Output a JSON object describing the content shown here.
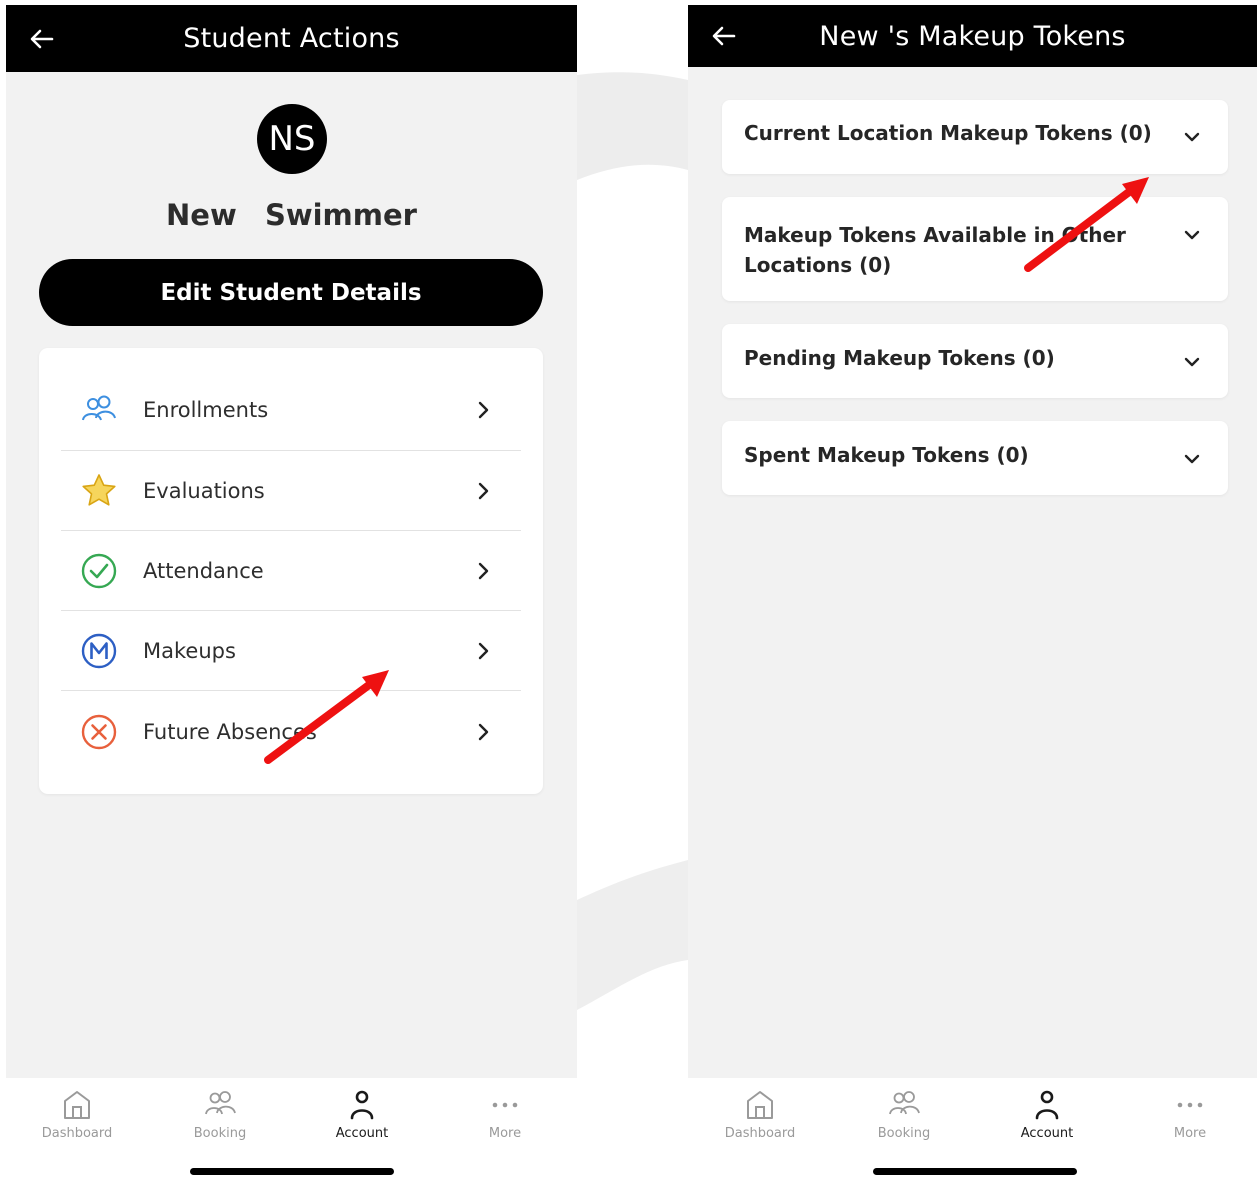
{
  "colors": {
    "header_bg": "#000000",
    "screen_bg": "#f2f2f2",
    "card_bg": "#ffffff",
    "annotation_arrow": "#ee1111",
    "nav_active": "#1a1a1a",
    "nav_inactive": "#9a9a9a"
  },
  "left_screen": {
    "header": {
      "title": "Student Actions",
      "back_icon": "arrow-left-icon"
    },
    "avatar_initials": "NS",
    "student_name": "New  Swimmer",
    "edit_button_label": "Edit Student Details",
    "menu_items": [
      {
        "label": "Enrollments",
        "icon": "people-icon",
        "icon_color": "#3d8fe0"
      },
      {
        "label": "Evaluations",
        "icon": "star-icon",
        "icon_color": "#e8b21c"
      },
      {
        "label": "Attendance",
        "icon": "check-circle-icon",
        "icon_color": "#36a853"
      },
      {
        "label": "Makeups",
        "icon": "makeup-m-icon",
        "icon_color": "#2d5fc4"
      },
      {
        "label": "Future Absences",
        "icon": "x-circle-icon",
        "icon_color": "#e8603c"
      }
    ]
  },
  "right_screen": {
    "header": {
      "title": "New 's Makeup Tokens",
      "back_icon": "arrow-left-icon"
    },
    "sections": [
      {
        "line1": "Current Location Makeup Tokens (0)",
        "line2": ""
      },
      {
        "line1": "Makeup Tokens Available in Other",
        "line2": "Locations (0)"
      },
      {
        "line1": "Pending Makeup Tokens (0)",
        "line2": ""
      },
      {
        "line1": "Spent Makeup Tokens (0)",
        "line2": ""
      }
    ]
  },
  "bottom_nav": {
    "items": [
      {
        "label": "Dashboard",
        "icon": "home-icon",
        "active": false
      },
      {
        "label": "Booking",
        "icon": "people-icon",
        "active": false
      },
      {
        "label": "Account",
        "icon": "person-icon",
        "active": true
      },
      {
        "label": "More",
        "icon": "more-dots-icon",
        "active": false
      }
    ]
  }
}
